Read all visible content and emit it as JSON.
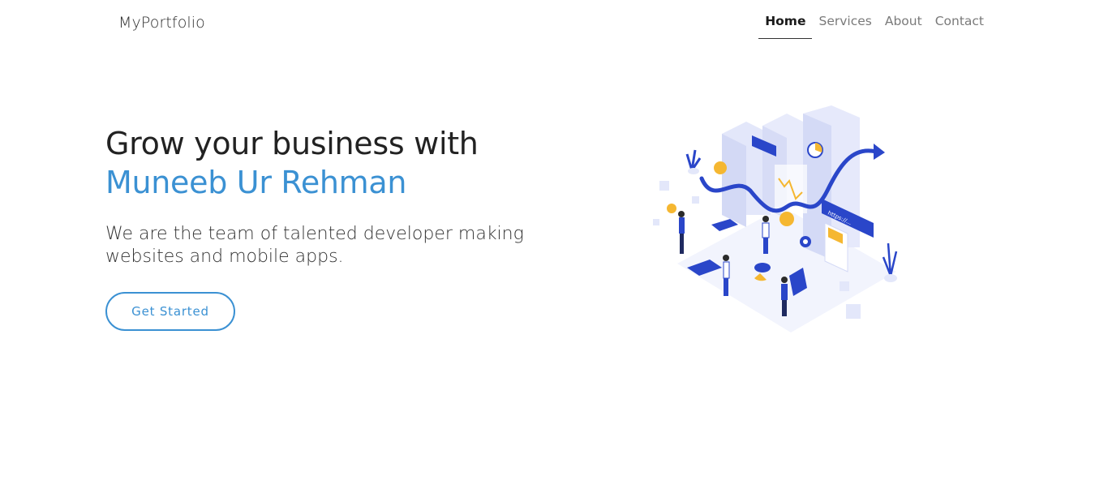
{
  "navbar": {
    "brand": "MyPortfolio",
    "links": [
      {
        "label": "Home",
        "active": true
      },
      {
        "label": "Services",
        "active": false
      },
      {
        "label": "About",
        "active": false
      },
      {
        "label": "Contact",
        "active": false
      }
    ]
  },
  "hero": {
    "headline": "Grow your business with",
    "name": "Muneeb Ur Rehman",
    "tagline": "We are the team of talented developer making websites and mobile apps.",
    "cta_label": "Get Started",
    "illustration_url_text": "https://..."
  },
  "colors": {
    "accent": "#3b91d3",
    "illustration_primary": "#2a46c9",
    "illustration_secondary": "#f5b731"
  }
}
